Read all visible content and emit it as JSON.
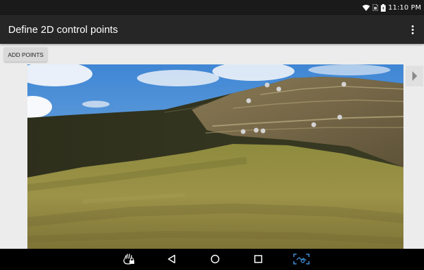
{
  "status_bar": {
    "time": "11:10 PM",
    "icons": [
      "wifi-icon",
      "sim-icon",
      "battery-icon"
    ]
  },
  "app_bar": {
    "title": "Define 2D control points",
    "menu_icon": "more-vert-icon"
  },
  "toolbar": {
    "add_points_label": "ADD POINTS"
  },
  "photo": {
    "subject": "hillside landscape photo",
    "control_points_count": 10
  },
  "next_button": {
    "icon": "chevron-right-icon"
  },
  "nav_bar": {
    "icons": [
      "gesture-lock-icon",
      "back-icon",
      "home-icon",
      "recents-icon",
      "screenshot-icon"
    ]
  },
  "colors": {
    "app_bar": "#262626",
    "status_bar": "#1a1a1a",
    "background": "#ececec",
    "accent_nav": "#3d8fd8",
    "control_point": "#d3d3d3"
  }
}
